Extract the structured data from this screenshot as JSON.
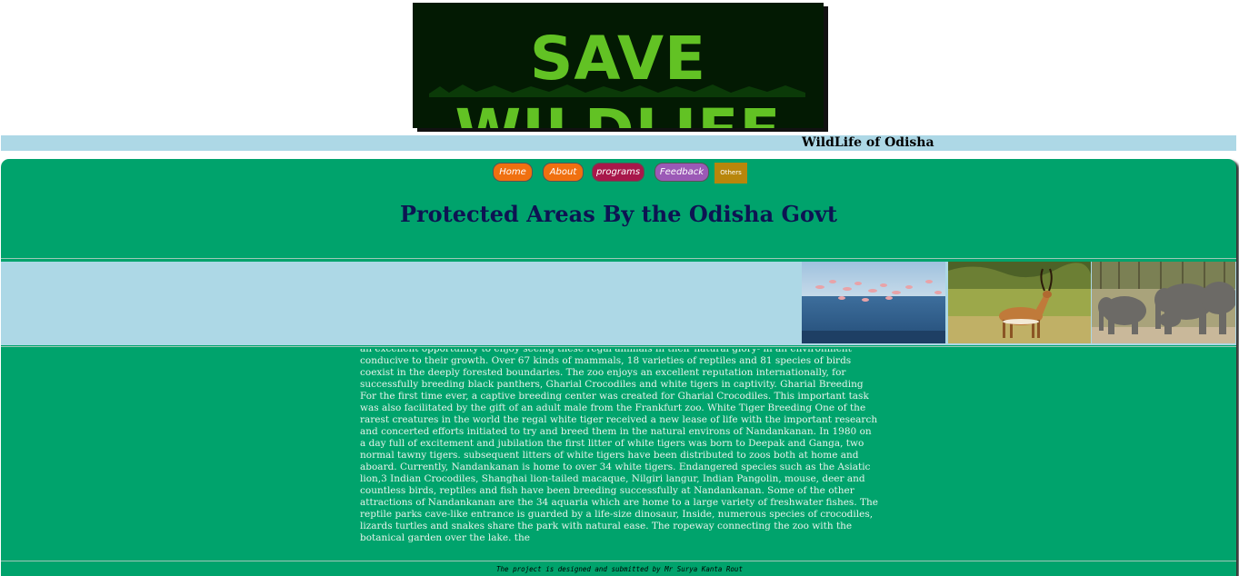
{
  "banner": {
    "title": "SAVE WILDLIFE"
  },
  "header": {
    "title": "WildLife of Odisha"
  },
  "nav": {
    "items": [
      {
        "label": "Home",
        "color": "#f07010"
      },
      {
        "label": "About",
        "color": "#f07010"
      },
      {
        "label": "programs",
        "color": "#a8174a"
      },
      {
        "label": "Feedback",
        "color": "#9b59b6"
      },
      {
        "label": "Others",
        "color": "#b8860b"
      }
    ]
  },
  "main": {
    "title": "Protected Areas By the Odisha Govt",
    "body": "an excellent opportunity to enjoy seeing these regal animals in their natural glory- in an environment conducive to their growth. Over 67 kinds of mammals, 18 varieties of reptiles and 81 species of birds coexist in the deeply forested boundaries. The zoo enjoys an excellent reputation internationally, for successfully breeding black panthers, Gharial Crocodiles and white tigers in captivity. Gharial Breeding For the first time ever, a captive breeding center was created for Gharial Crocodiles. This important task was also facilitated by the gift of an adult male from the Frankfurt zoo. White Tiger Breeding One of the rarest creatures in the world the regal white tiger received a new lease of life with the important research and concerted efforts initiated to try and breed them in the natural environs of Nandankanan. In 1980 on a day full of excitement and jubilation the first litter of white tigers was born to Deepak and Ganga, two normal tawny tigers. subsequent litters of white tigers have been distributed to zoos both at home and aboard. Currently, Nandankanan is home to over 34 white tigers. Endangered species such as the Asiatic lion,3 Indian Crocodiles, Shanghai lion-tailed macaque, Nilgiri langur, Indian Pangolin, mouse, deer and countless birds, reptiles and fish have been breeding successfully at Nandankanan. Some of the other attractions of Nandankanan are the 34 aquaria which are home to a large variety of freshwater fishes. The reptile parks cave-like entrance is guarded by a life-size dinosaur, Inside, numerous species of crocodiles, lizards turtles and snakes share the park with natural ease. The ropeway connecting the zoo with the botanical garden over the lake. the"
  },
  "photos": [
    {
      "name": "flamingo-photo"
    },
    {
      "name": "antelope-photo"
    },
    {
      "name": "elephant-photo"
    }
  ],
  "footer": {
    "text": "The project is designed and submitted by Mr Surya Kanta Rout"
  },
  "colors": {
    "panel": "#00a36c",
    "band": "#add8e6",
    "title": "#0d1452"
  }
}
